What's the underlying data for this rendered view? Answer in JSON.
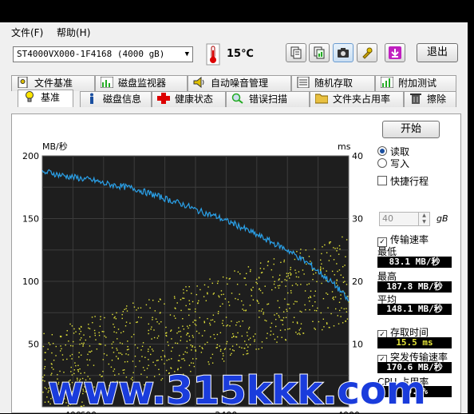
{
  "menu": {
    "file": "文件(F)",
    "help": "帮助(H)"
  },
  "toolbar": {
    "drive": "ST4000VX000-1F4168 (4000 gB)",
    "temperature": "15℃",
    "exit": "退出"
  },
  "tabs_top": [
    "文件基准",
    "磁盘监视器",
    "自动噪音管理",
    "随机存取",
    "附加测试"
  ],
  "tabs_bottom": [
    "基准",
    "磁盘信息",
    "健康状态",
    "错误扫描",
    "文件夹占用率",
    "擦除"
  ],
  "active_tab": "基准",
  "side": {
    "start": "开始",
    "read": "读取",
    "write": "写入",
    "quick_travel": "快捷行程",
    "quick_value": "40",
    "quick_unit": "gB",
    "transfer_rate": "传输速率",
    "min_label": "最低",
    "min_value": "83.1 MB/秒",
    "max_label": "最高",
    "max_value": "187.8 MB/秒",
    "avg_label": "平均",
    "avg_value": "148.1 MB/秒",
    "access_time": "存取时间",
    "access_value": "15.5 ms",
    "burst_rate": "突发传输速率",
    "burst_value": "170.6 MB/秒",
    "cpu_label": "CPU 占用率",
    "cpu_value": "10.4%"
  },
  "watermark": "www.315kkk.com",
  "chart_data": {
    "type": "line",
    "ylabel_left": "MB/秒",
    "ylabel_right": "ms",
    "y_left_ticks": [
      200,
      150,
      100,
      50
    ],
    "y_right_ticks": [
      40,
      30,
      20,
      10
    ],
    "ylim_left": [
      0,
      200
    ],
    "ylim_right": [
      0,
      40
    ],
    "xlim": [
      0,
      4000
    ],
    "x_ticks_visible": [
      400,
      600,
      2400,
      4000
    ],
    "series": [
      {
        "color": "#2aa0e8",
        "x": [
          0,
          100,
          200,
          300,
          400,
          500,
          600,
          700,
          800,
          900,
          1000,
          1100,
          1200,
          1300,
          1400,
          1500,
          1600,
          1700,
          1800,
          1900,
          2000,
          2100,
          2200,
          2300,
          2400,
          2500,
          2600,
          2700,
          2800,
          2900,
          3000,
          3100,
          3200,
          3300,
          3400,
          3500,
          3600,
          3700,
          3800,
          3900,
          4000
        ],
        "values": [
          186,
          187,
          185,
          184,
          183,
          182,
          181,
          180,
          178,
          177,
          176,
          175,
          174,
          172,
          170,
          168,
          166,
          164,
          162,
          160,
          157,
          155,
          153,
          151,
          148,
          146,
          143,
          140,
          137,
          134,
          131,
          128,
          125,
          121,
          117,
          113,
          108,
          103,
          98,
          92,
          84
        ]
      }
    ],
    "scatter": {
      "color": "#e6e63a",
      "description_range_ms": [
        5,
        26
      ]
    },
    "colors": {
      "background": "#1e1e1e",
      "grid": "#3c3c3c"
    }
  }
}
